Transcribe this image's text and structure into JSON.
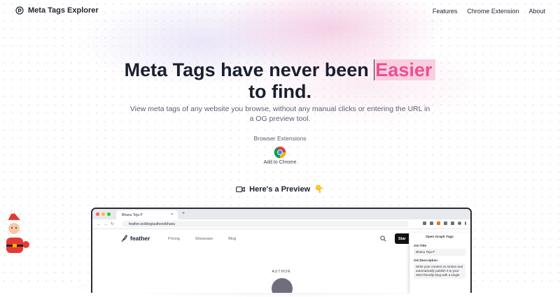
{
  "nav": {
    "logo_text": "Meta Tags Explorer",
    "links": [
      "Features",
      "Chrome Extension",
      "About"
    ]
  },
  "hero": {
    "title_part1": "Meta Tags have never been",
    "title_highlight": "Easier",
    "title_part2": "to find.",
    "subtitle": "View meta tags of any website you browse, without any manual clicks or entering the URL in a OG preview tool.",
    "extensions_label": "Browser Extensions",
    "add_to_chrome_label": "Add to Chrome",
    "preview_label": "Here's a Preview",
    "preview_emoji": "👇"
  },
  "browser": {
    "tab_title": "Bhanu Teja P",
    "url": "feather.so/blog/authors/bhanu",
    "site": {
      "brand": "feather",
      "nav": [
        "Pricing",
        "Showcase",
        "Blog"
      ],
      "start_button": "Star",
      "author_label": "AUTHOR"
    },
    "panel": {
      "title": "Open Graph Tags",
      "og_title_label": "OG:Title",
      "og_title_value": "Bhanu Teja P",
      "og_description_label": "OG:Description",
      "og_description_value": "Write your content on Notion and automatically publish it to your SEO-friendly blog with a single"
    }
  },
  "colors": {
    "accent_pink": "#ec4f93",
    "highlight_bg": "#f7cfe0",
    "text_dark": "#1a1f2e"
  }
}
